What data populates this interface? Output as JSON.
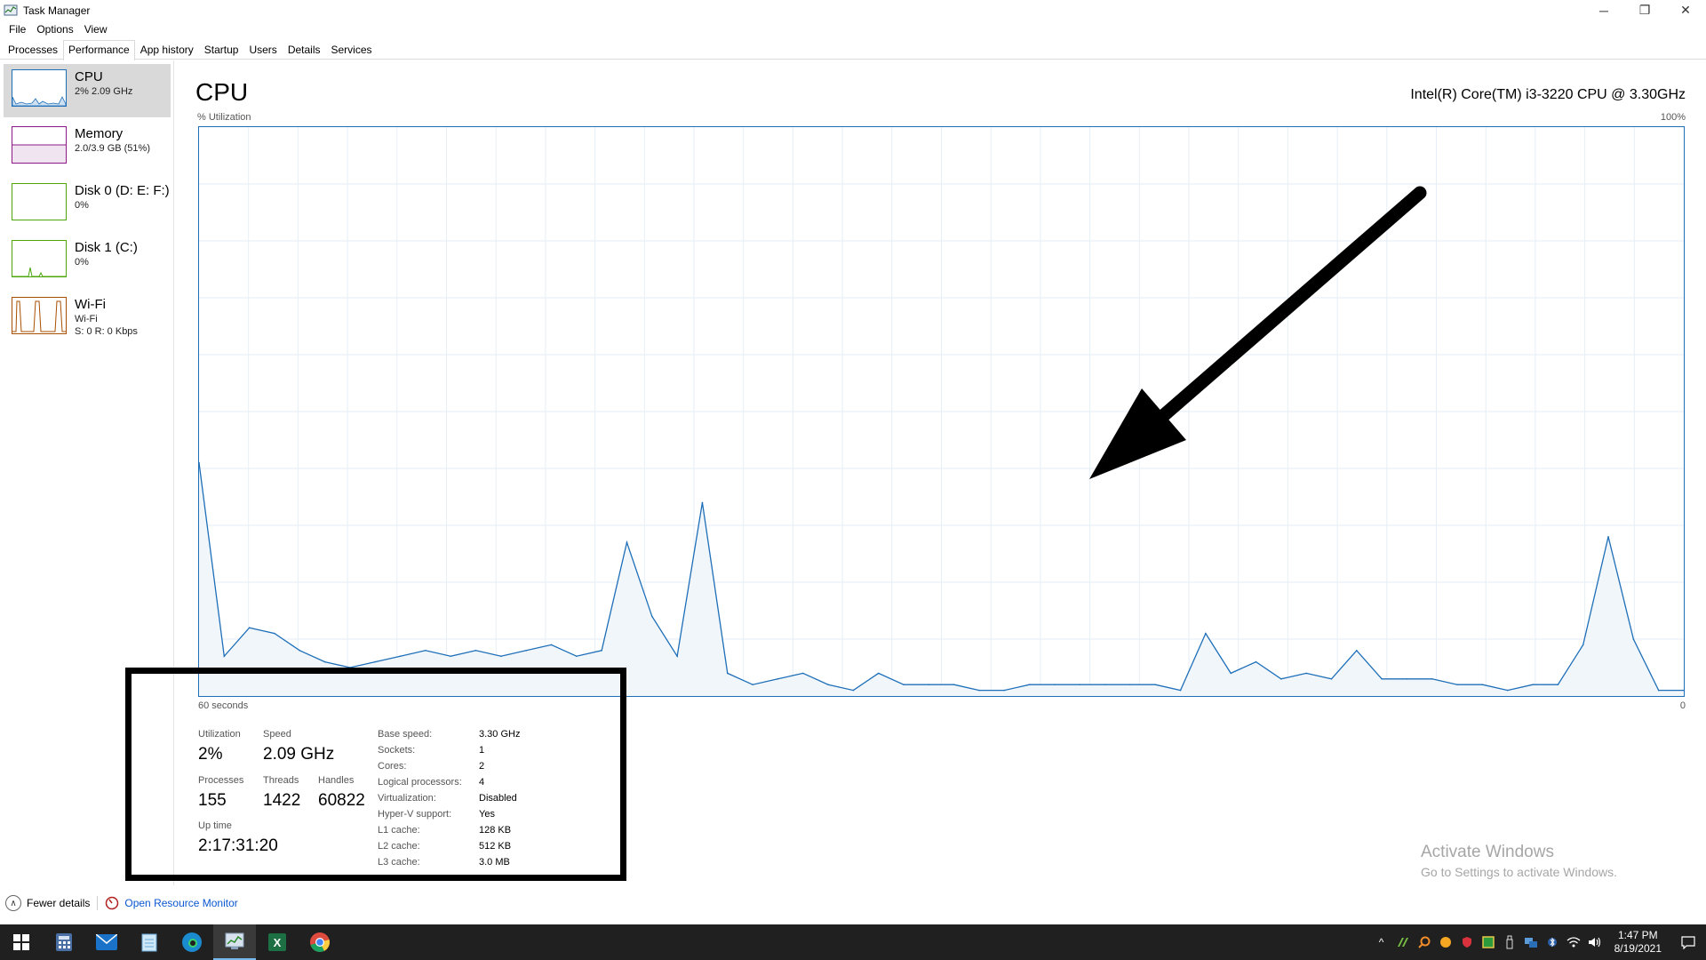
{
  "window": {
    "title": "Task Manager",
    "minimize_glyph": "─",
    "restore_glyph": "❐",
    "close_glyph": "✕"
  },
  "menu": [
    "File",
    "Options",
    "View"
  ],
  "tabs": [
    "Processes",
    "Performance",
    "App history",
    "Startup",
    "Users",
    "Details",
    "Services"
  ],
  "active_tab": "Performance",
  "sidebar": {
    "items": [
      {
        "title": "CPU",
        "sub1": "2% 2.09 GHz",
        "sub2": "",
        "color": "#1e6fb8",
        "icon": "cpu-thumbnail"
      },
      {
        "title": "Memory",
        "sub1": "2.0/3.9 GB (51%)",
        "sub2": "",
        "color": "#8b1a89",
        "icon": "memory-thumbnail"
      },
      {
        "title": "Disk 0 (D: E: F:)",
        "sub1": "0%",
        "sub2": "",
        "color": "#4da60c",
        "icon": "disk-thumbnail"
      },
      {
        "title": "Disk 1 (C:)",
        "sub1": "0%",
        "sub2": "",
        "color": "#4da60c",
        "icon": "disk-thumbnail"
      },
      {
        "title": "Wi-Fi",
        "sub1": "Wi-Fi",
        "sub2": "S: 0 R: 0 Kbps",
        "color": "#a74f01",
        "icon": "wifi-thumbnail"
      }
    ]
  },
  "main": {
    "title": "CPU",
    "model": "Intel(R) Core(TM) i3-3220 CPU @ 3.30GHz",
    "util_label": "% Utilization",
    "max_label": "100%",
    "time_label": "60 seconds",
    "zero_label": "0"
  },
  "chart_data": {
    "type": "area",
    "title": "",
    "xlabel": "60 seconds",
    "ylabel": "% Utilization",
    "ylim": [
      0,
      100
    ],
    "series": [
      {
        "values": [
          41,
          7,
          12,
          11,
          8,
          6,
          5,
          6,
          7,
          8,
          7,
          8,
          7,
          8,
          9,
          7,
          8,
          27,
          14,
          7,
          34,
          4,
          2,
          3,
          4,
          2,
          1,
          4,
          2,
          2,
          2,
          1,
          1,
          2,
          2,
          2,
          2,
          2,
          2,
          1,
          11,
          4,
          6,
          3,
          4,
          3,
          8,
          3,
          3,
          3,
          2,
          2,
          1,
          2,
          2,
          9,
          28,
          10,
          1,
          1
        ]
      }
    ],
    "grid": true,
    "color": "#1e6fb8",
    "fill": "#f1f6fb"
  },
  "stats": {
    "utilization": {
      "label": "Utilization",
      "value": "2%"
    },
    "speed": {
      "label": "Speed",
      "value": "2.09 GHz"
    },
    "processes": {
      "label": "Processes",
      "value": "155"
    },
    "threads": {
      "label": "Threads",
      "value": "1422"
    },
    "handles": {
      "label": "Handles",
      "value": "60822"
    },
    "uptime": {
      "label": "Up time",
      "value": "2:17:31:20"
    },
    "details": [
      {
        "key": "Base speed:",
        "value": "3.30 GHz"
      },
      {
        "key": "Sockets:",
        "value": "1"
      },
      {
        "key": "Cores:",
        "value": "2"
      },
      {
        "key": "Logical processors:",
        "value": "4"
      },
      {
        "key": "Virtualization:",
        "value": "Disabled"
      },
      {
        "key": "Hyper-V support:",
        "value": "Yes"
      },
      {
        "key": "L1 cache:",
        "value": "128 KB"
      },
      {
        "key": "L2 cache:",
        "value": "512 KB"
      },
      {
        "key": "L3 cache:",
        "value": "3.0 MB"
      }
    ]
  },
  "watermark": {
    "title": "Activate Windows",
    "subtitle": "Go to Settings to activate Windows."
  },
  "bottom": {
    "fewer_details": "Fewer details",
    "resource_monitor": "Open Resource Monitor"
  },
  "taskbar": {
    "apps": [
      "windows-start",
      "calculator",
      "mail",
      "notepad",
      "edge",
      "task-manager",
      "excel",
      "chrome"
    ],
    "time": "1:47 PM",
    "date": "8/19/2021",
    "chevron_glyph": "^"
  },
  "colors": {
    "cpu": "#1e6fb8",
    "sidebar_active": "#d9d9d9",
    "taskbar": "#202020",
    "link": "#0b57d0"
  }
}
